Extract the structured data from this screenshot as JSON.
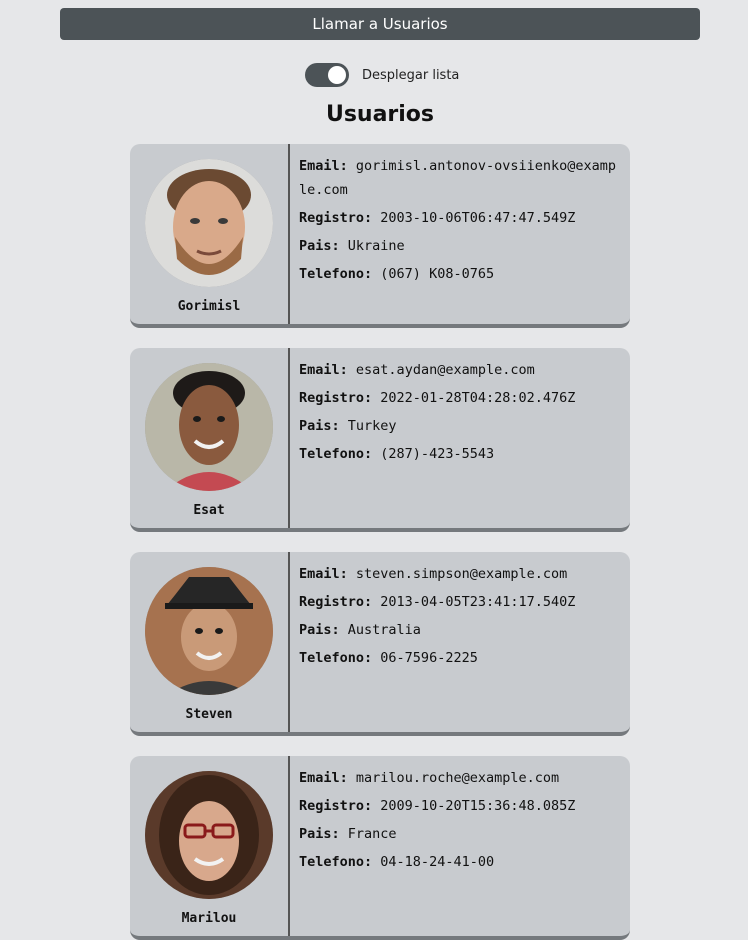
{
  "header": {
    "call_button_label": "Llamar a Usuarios",
    "toggle_label": "Desplegar lista",
    "toggle_on": true
  },
  "section_title": "Usuarios",
  "labels": {
    "email": "Email:",
    "registro": "Registro:",
    "pais": "Pais:",
    "telefono": "Telefono:"
  },
  "users": [
    {
      "name": "Gorimisl",
      "email": "gorimisl.antonov-ovsiienko@example.com",
      "registro": "2003-10-06T06:47:47.549Z",
      "pais": "Ukraine",
      "telefono": "(067) K08-0765"
    },
    {
      "name": "Esat",
      "email": "esat.aydan@example.com",
      "registro": "2022-01-28T04:28:02.476Z",
      "pais": "Turkey",
      "telefono": "(287)-423-5543"
    },
    {
      "name": "Steven",
      "email": "steven.simpson@example.com",
      "registro": "2013-04-05T23:41:17.540Z",
      "pais": "Australia",
      "telefono": "06-7596-2225"
    },
    {
      "name": "Marilou",
      "email": "marilou.roche@example.com",
      "registro": "2009-10-20T15:36:48.085Z",
      "pais": "France",
      "telefono": "04-18-24-41-00"
    }
  ],
  "colors": {
    "background": "#e6e7e9",
    "button": "#4c5357",
    "card": "#c8cbcf"
  }
}
